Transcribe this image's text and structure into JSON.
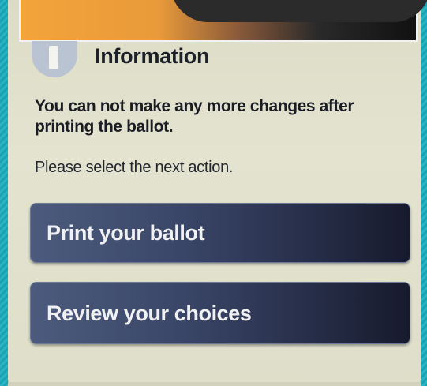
{
  "dialog": {
    "title": "Information",
    "message": "You can not make any more changes after printing the ballot.",
    "prompt": "Please select the next action.",
    "icon": "info-icon"
  },
  "actions": {
    "print_label": "Print your ballot",
    "review_label": "Review your choices"
  },
  "colors": {
    "button_bg": "#2f3a5c",
    "screen_bg": "#e0e0cc",
    "frame": "#1fa9b8"
  }
}
